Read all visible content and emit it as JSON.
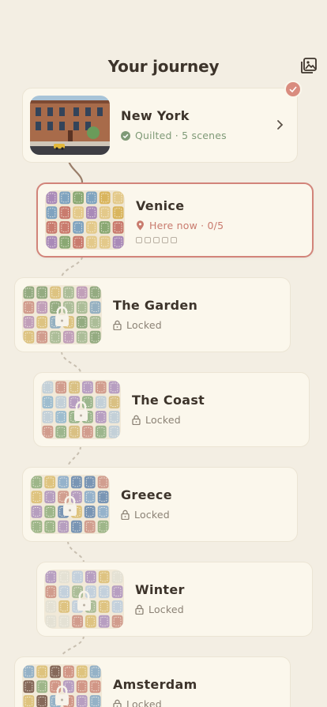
{
  "header": {
    "title": "Your journey",
    "gallery_icon": "gallery-icon"
  },
  "colors": {
    "background": "#f3eee3",
    "card": "#fbf7ec",
    "accent": "#d2847a",
    "quilted_green": "#7f9a77",
    "locked_gray": "#8b8275"
  },
  "journey": [
    {
      "name": "New York",
      "status": "Quilted · 5 scenes",
      "state": "quilted",
      "icon": "check-circle-icon"
    },
    {
      "name": "Venice",
      "status": "Here now · 0/5",
      "state": "current",
      "icon": "location-pin-icon",
      "progress_total": 5,
      "progress_done": 0
    },
    {
      "name": "The Garden",
      "status": "Locked",
      "state": "locked",
      "icon": "lock-icon"
    },
    {
      "name": "The Coast",
      "status": "Locked",
      "state": "locked",
      "icon": "lock-icon"
    },
    {
      "name": "Greece",
      "status": "Locked",
      "state": "locked",
      "icon": "lock-icon"
    },
    {
      "name": "Winter",
      "status": "Locked",
      "state": "locked",
      "icon": "lock-icon"
    },
    {
      "name": "Amsterdam",
      "status": "Locked",
      "state": "locked",
      "icon": "lock-icon"
    }
  ]
}
